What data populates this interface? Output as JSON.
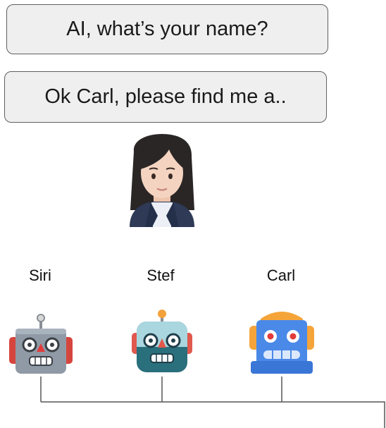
{
  "prompts": {
    "question": "AI, what’s your name?",
    "command": "Ok Carl, please find me a.."
  },
  "user": {
    "icon": "woman-office-worker-icon"
  },
  "assistants": [
    {
      "label": "Siri",
      "icon": "gray-robot-icon"
    },
    {
      "label": "Stef",
      "icon": "teal-robot-icon"
    },
    {
      "label": "Carl",
      "icon": "blue-robot-icon"
    }
  ],
  "colors": {
    "bubble_fill": "#efefef",
    "bubble_border": "#5f5f5f",
    "connector": "#555555"
  }
}
